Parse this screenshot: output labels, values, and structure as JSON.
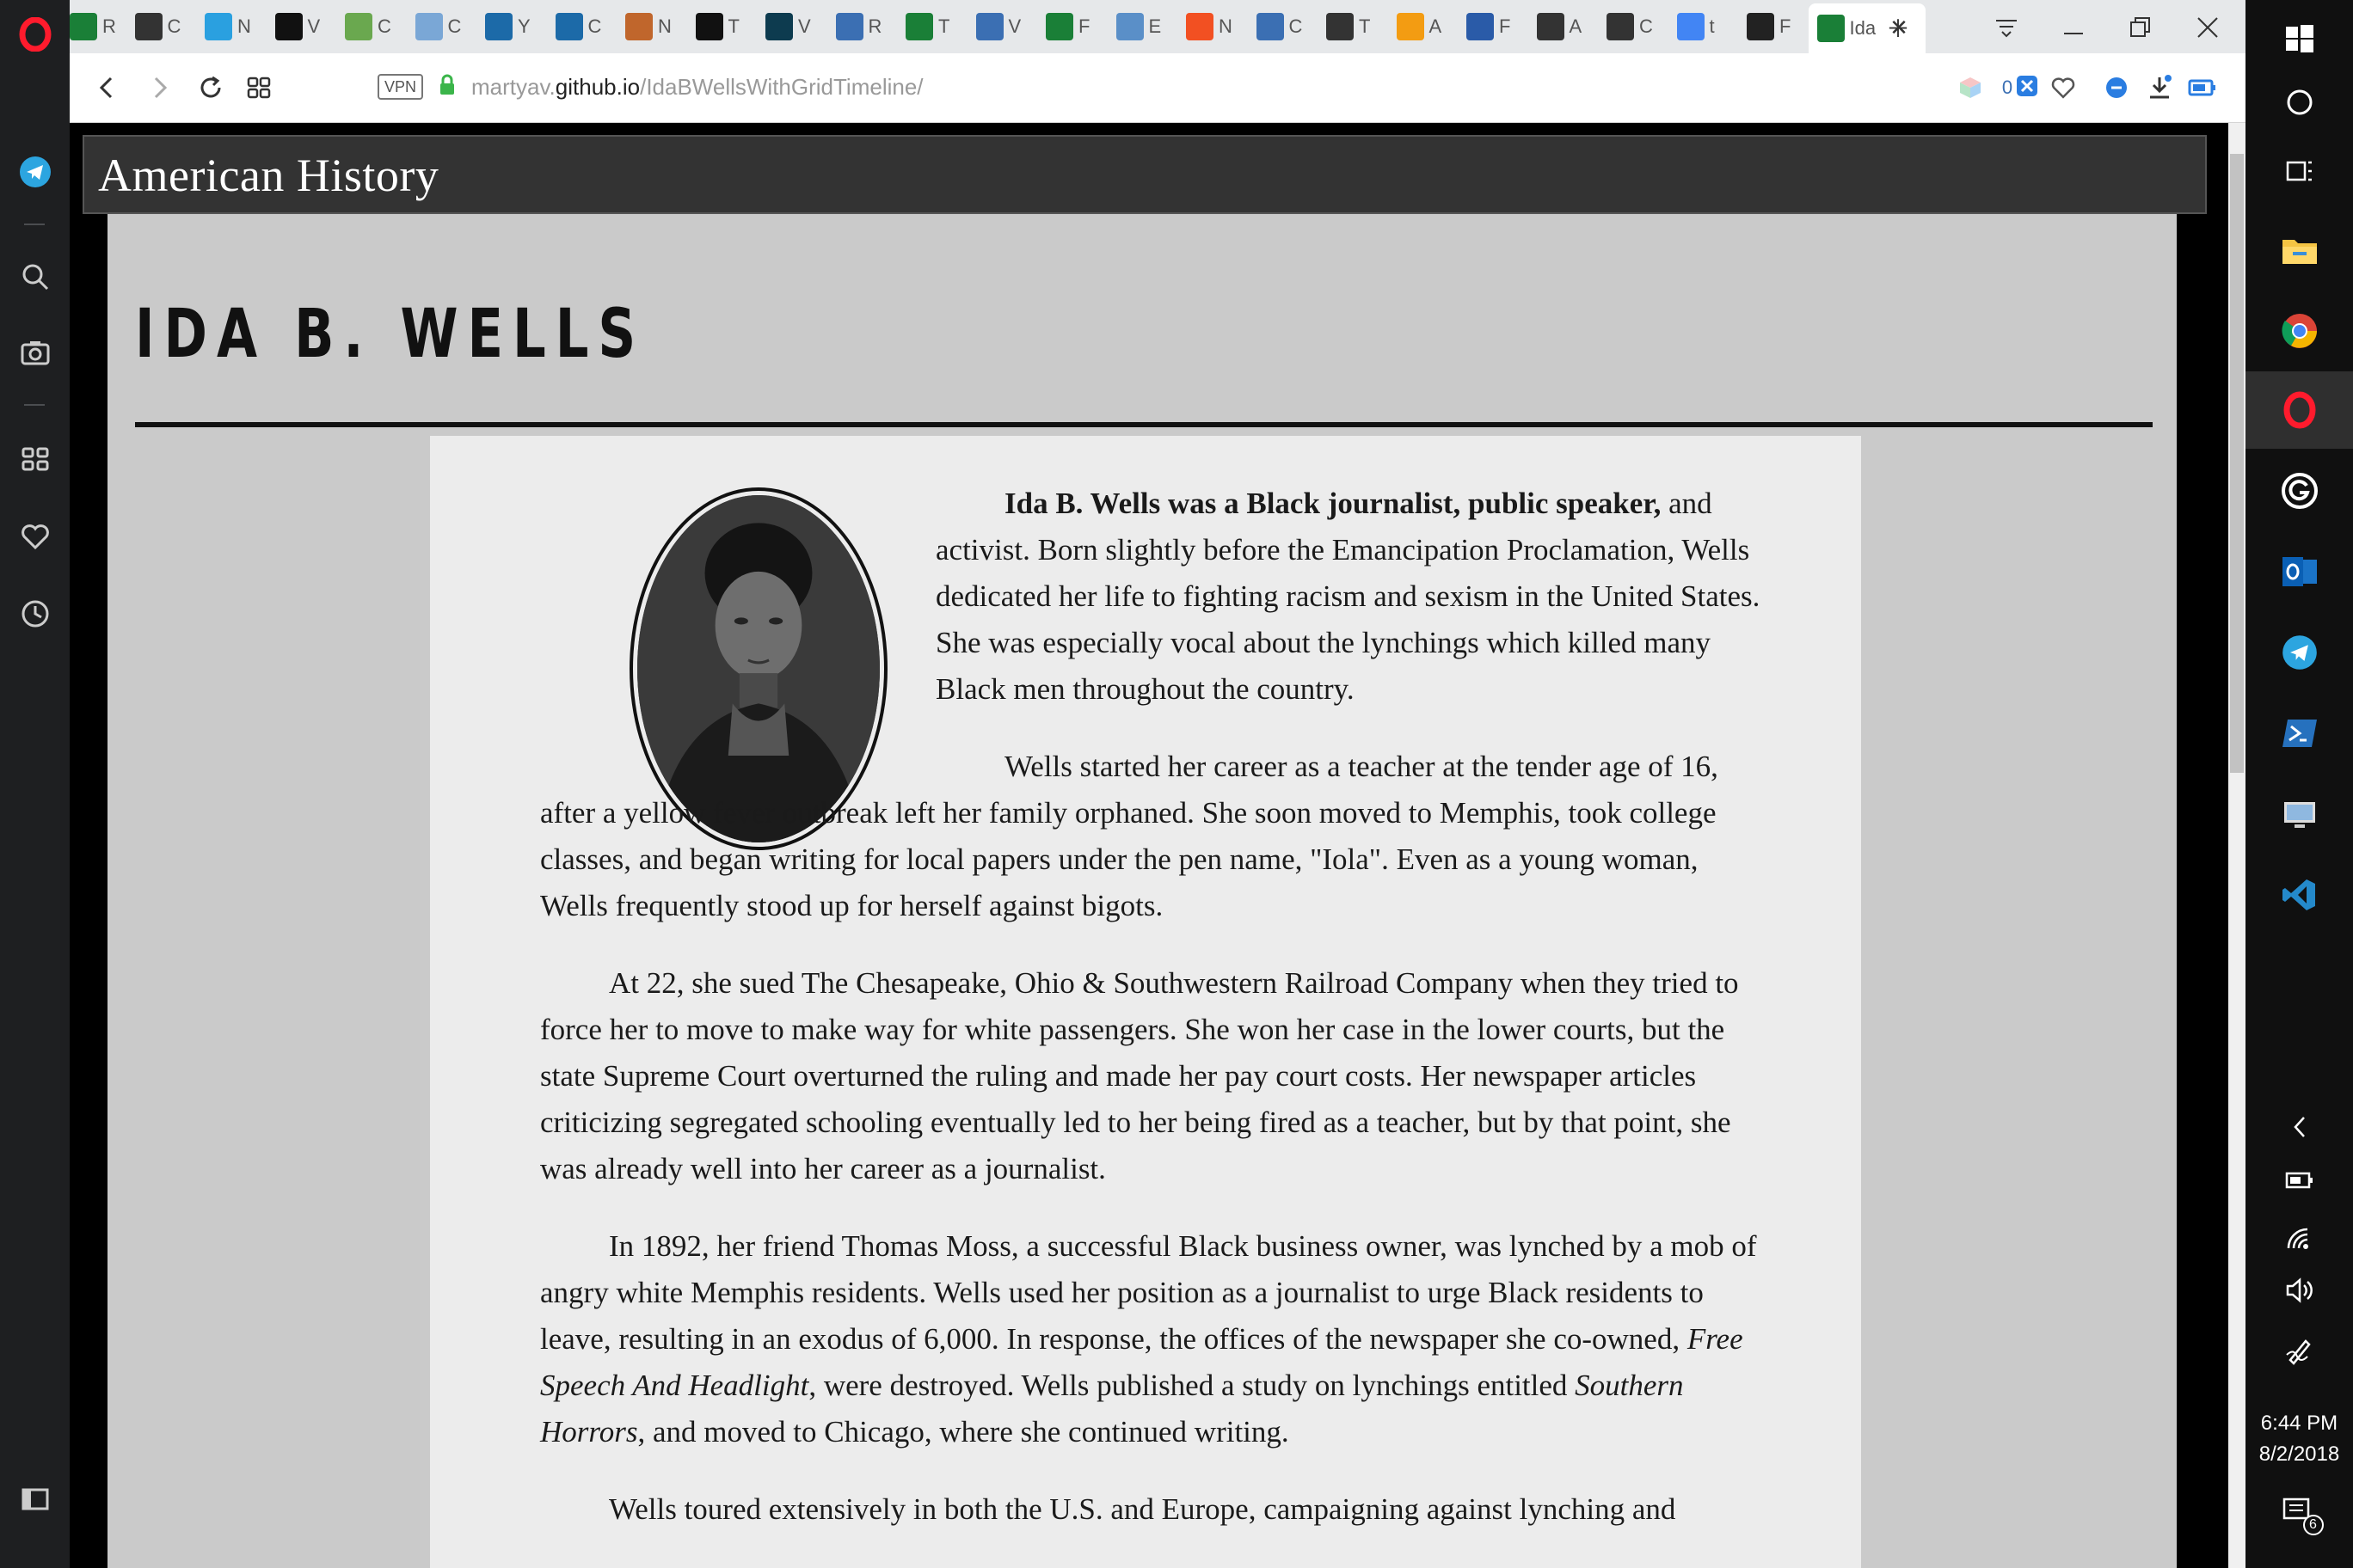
{
  "browser": {
    "tabs": [
      {
        "icon": "code-icon",
        "label": "R",
        "color": "#1a7f37"
      },
      {
        "icon": "codepen-icon",
        "label": "C",
        "color": "#333"
      },
      {
        "icon": "graduation-icon",
        "label": "N",
        "color": "#2aa0e0"
      },
      {
        "icon": "dev-icon",
        "label": "V",
        "color": "#111"
      },
      {
        "icon": "cloud-icon",
        "label": "C",
        "color": "#6aa84f"
      },
      {
        "icon": "css-icon",
        "label": "C",
        "color": "#7aa7d6"
      },
      {
        "icon": "react-icon",
        "label": "Y",
        "color": "#1c6aa8"
      },
      {
        "icon": "react-icon",
        "label": "C",
        "color": "#1c6aa8"
      },
      {
        "icon": "person-icon",
        "label": "N",
        "color": "#c0662c"
      },
      {
        "icon": "dev-icon",
        "label": "T",
        "color": "#111"
      },
      {
        "icon": "wave-icon",
        "label": "V",
        "color": "#0d3b4f"
      },
      {
        "icon": "terminal-icon",
        "label": "R",
        "color": "#3b6fb3"
      },
      {
        "icon": "code-icon",
        "label": "T",
        "color": "#1a7f37"
      },
      {
        "icon": "v-icon",
        "label": "V",
        "color": "#3b6fb3"
      },
      {
        "icon": "code-icon",
        "label": "F",
        "color": "#1a7f37"
      },
      {
        "icon": "window-icon",
        "label": "E",
        "color": "#5a8fc8"
      },
      {
        "icon": "windows-icon",
        "label": "N",
        "color": "#f25022"
      },
      {
        "icon": "grid-icon",
        "label": "C",
        "color": "#3b6fb3"
      },
      {
        "icon": "pin-icon",
        "label": "T",
        "color": "#333"
      },
      {
        "icon": "asterisk-icon",
        "label": "A",
        "color": "#f39c12"
      },
      {
        "icon": "nyc-icon",
        "label": "F",
        "color": "#2a5ba8"
      },
      {
        "icon": "codepen-icon",
        "label": "A",
        "color": "#333"
      },
      {
        "icon": "codepen-icon",
        "label": "C",
        "color": "#333"
      },
      {
        "icon": "google-icon",
        "label": "t",
        "color": "#4285f4"
      },
      {
        "icon": "camera-icon",
        "label": "F",
        "color": "#222"
      },
      {
        "icon": "page-icon",
        "label": "Ida",
        "color": "#1a7f37"
      }
    ],
    "url_prefix": "martyav.",
    "url_domain": "github.io",
    "url_path": "/IdaBWellsWithGridTimeline/",
    "vpn_label": "VPN",
    "adblock_count": "0"
  },
  "page": {
    "header": "American History",
    "title": "IDA B. WELLS",
    "paragraphs": {
      "p1_lead": "Ida B. Wells was a Black journalist, public speaker,",
      "p1_rest": " and activist. Born slightly before the Emancipation Proclamation, Wells dedicated her life to fighting racism and sexism in the United States. She was especially vocal about the lynchings which killed many Black men throughout the country.",
      "p2": "Wells started her career as a teacher at the tender age of 16, after a yellow fever outbreak left her family orphaned. She soon moved to Memphis, took college classes, and began writing for local papers under the pen name, \"Iola\". Even as a young woman, Wells frequently stood up for herself against bigots.",
      "p3": "At 22, she sued The Chesapeake, Ohio & Southwestern Railroad Company when they tried to force her to move to make way for white passengers. She won her case in the lower courts, but the state Supreme Court overturned the ruling and made her pay court costs. Her newspaper articles criticizing segregated schooling eventually led to her being fired as a teacher, but by that point, she was already well into her career as a journalist.",
      "p4_a": "In 1892, her friend Thomas Moss, a successful Black business owner, was lynched by a mob of angry white Memphis residents. Wells used her position as a journalist to urge Black residents to leave, resulting in an exodus of 6,000. In response, the offices of the newspaper she co-owned, ",
      "p4_em1": "Free Speech And Headlight",
      "p4_b": ", were destroyed. Wells published a study on lynchings entitled ",
      "p4_em2": "Southern Horrors",
      "p4_c": ", and moved to Chicago, where she continued writing.",
      "p5": "Wells toured extensively in both the U.S. and Europe, campaigning against lynching and"
    }
  },
  "taskbar": {
    "time": "6:44 PM",
    "date": "8/2/2018",
    "notification_count": "6"
  }
}
